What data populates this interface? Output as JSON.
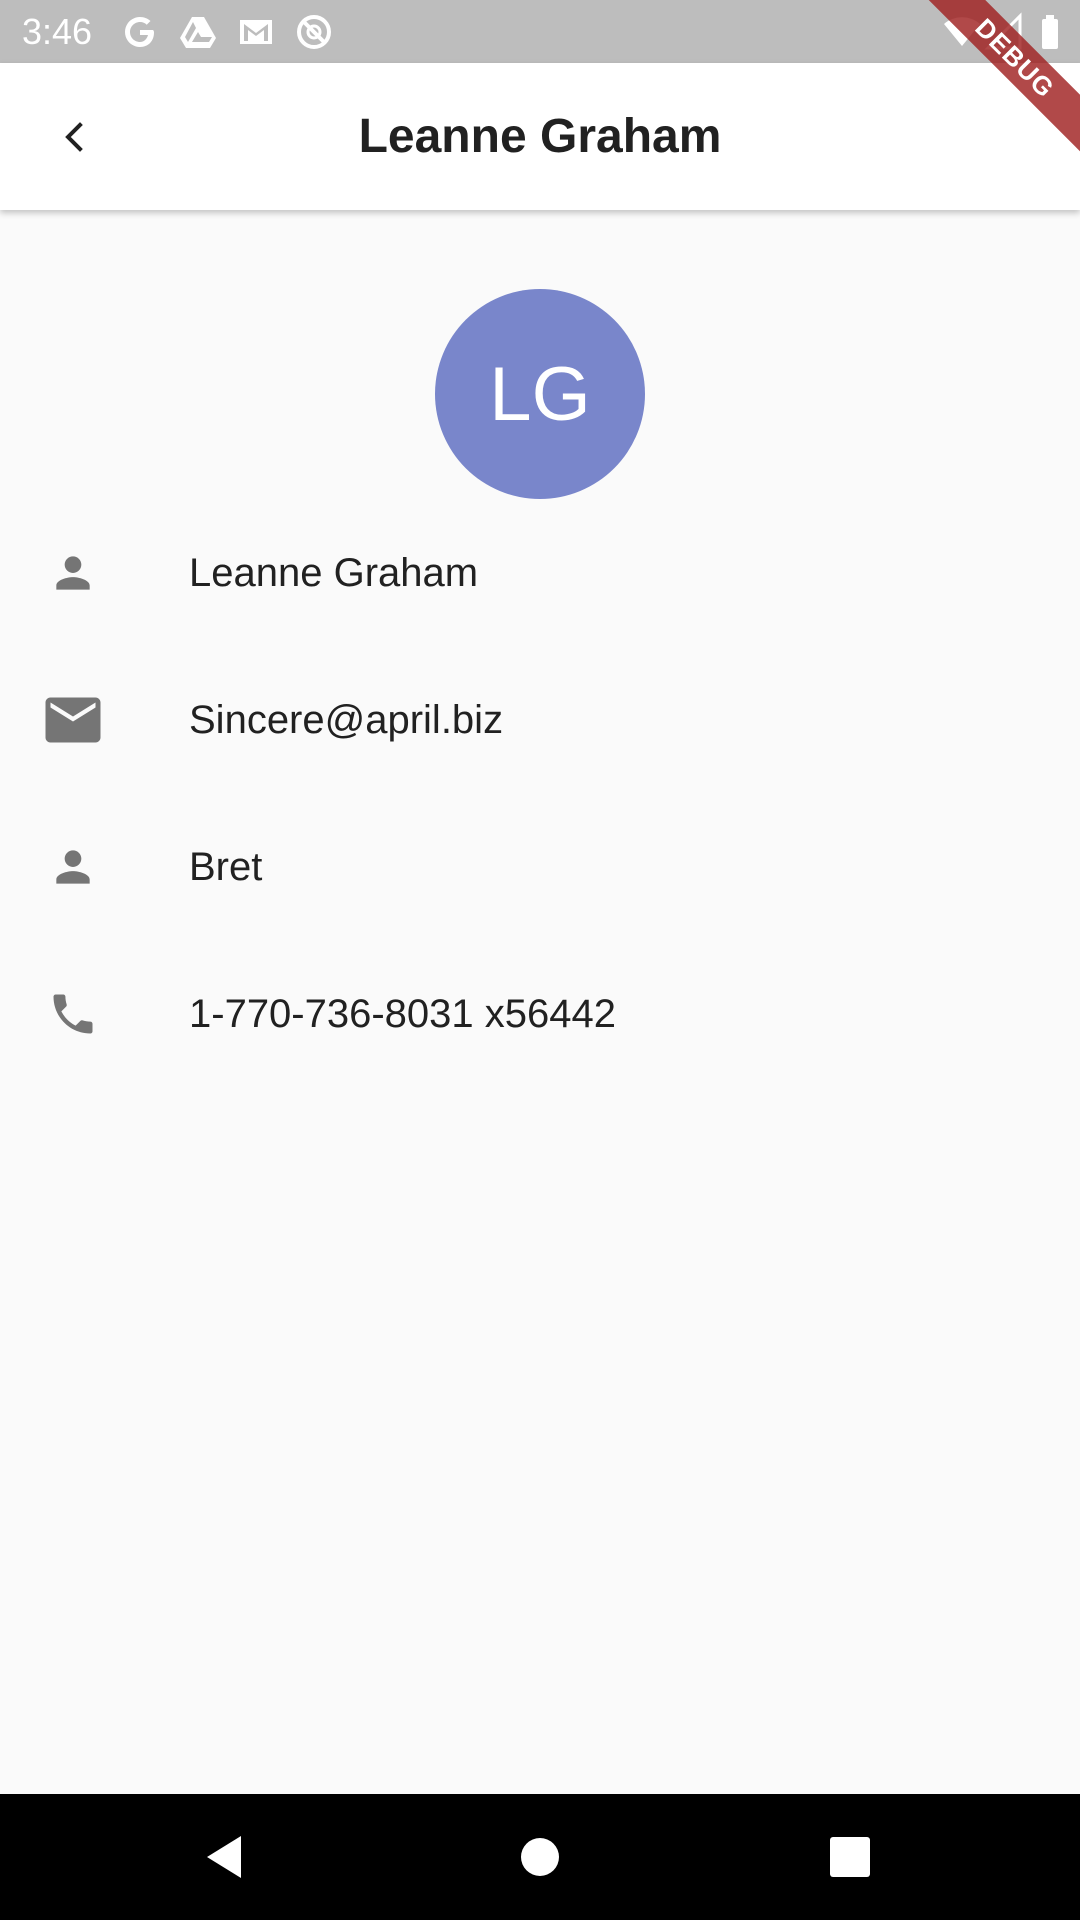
{
  "status_bar": {
    "time": "3:46",
    "left_icons": [
      "google-g-icon",
      "drive-icon",
      "gmail-icon",
      "circle-slash-icon"
    ],
    "right_icons": [
      "wifi-icon",
      "signal-icon",
      "battery-icon"
    ]
  },
  "app_bar": {
    "title": "Leanne Graham",
    "back_icon": "chevron-left-icon"
  },
  "avatar": {
    "initials": "LG",
    "color": "#7986cb"
  },
  "details": [
    {
      "icon": "person-icon",
      "value": "Leanne Graham"
    },
    {
      "icon": "email-icon",
      "value": "Sincere@april.biz"
    },
    {
      "icon": "person-icon",
      "value": "Bret"
    },
    {
      "icon": "phone-icon",
      "value": "1-770-736-8031 x56442"
    }
  ],
  "debug_banner": "DEBUG",
  "nav_bar": {
    "buttons": [
      "back-triangle-icon",
      "home-circle-icon",
      "recents-square-icon"
    ]
  }
}
